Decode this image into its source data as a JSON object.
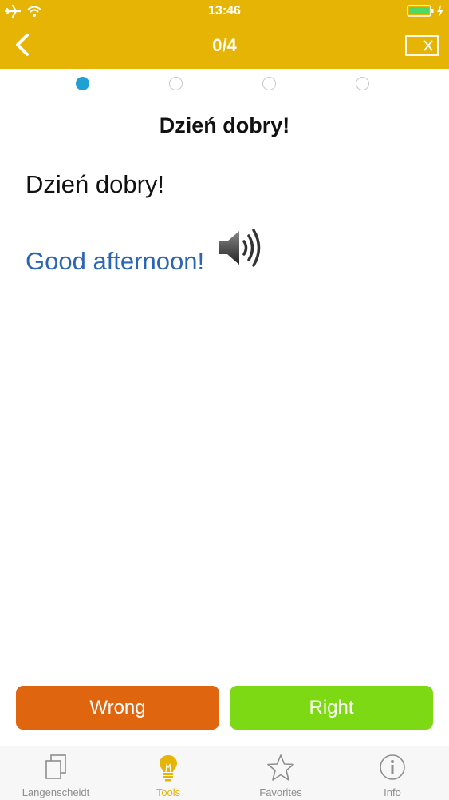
{
  "status": {
    "time": "13:46"
  },
  "nav": {
    "title": "0/4"
  },
  "progress": {
    "total": 4,
    "current": 1
  },
  "card": {
    "title": "Dzień dobry!",
    "source": "Dzień dobry!",
    "translation": "Good afternoon!"
  },
  "actions": {
    "wrong_label": "Wrong",
    "right_label": "Right"
  },
  "tabs": [
    {
      "label": "Langenscheidt",
      "icon": "book-icon"
    },
    {
      "label": "Tools",
      "icon": "lightbulb-icon"
    },
    {
      "label": "Favorites",
      "icon": "star-icon"
    },
    {
      "label": "Info",
      "icon": "info-icon"
    }
  ],
  "colors": {
    "header": "#e6b405",
    "wrong": "#e0650f",
    "right": "#7dd914",
    "progress_active": "#1ea0d6",
    "translation": "#2a66b3"
  }
}
